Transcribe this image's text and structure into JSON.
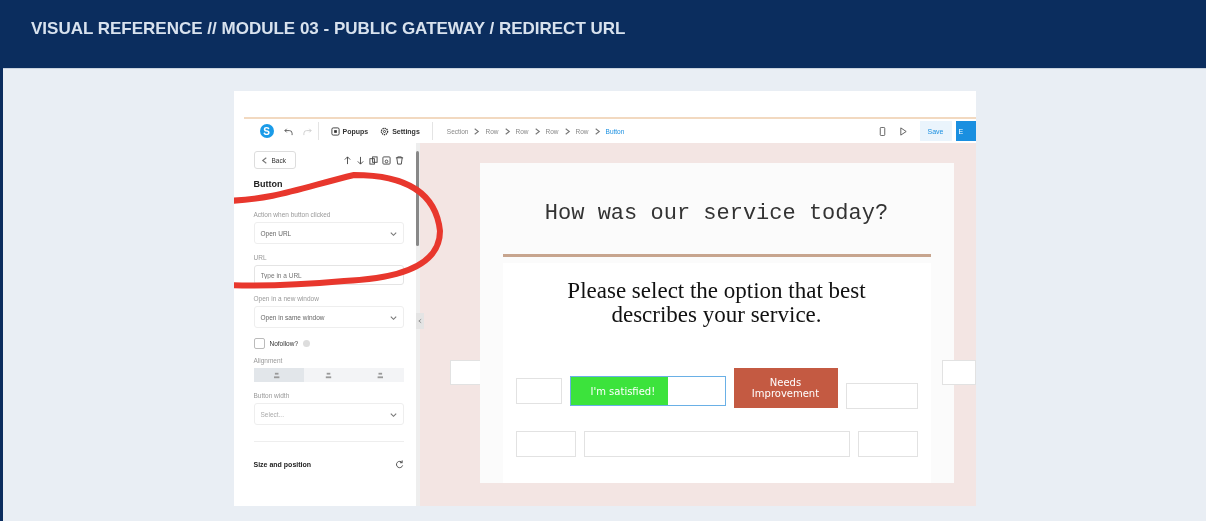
{
  "header": {
    "title": "VISUAL REFERENCE // MODULE 03 - PUBLIC GATEWAY / REDIRECT URL"
  },
  "toolbar": {
    "logo": "S",
    "menu": [
      {
        "label": "Popups",
        "kind": "popups"
      },
      {
        "label": "Settings",
        "kind": "settings"
      }
    ],
    "breadcrumbs": [
      {
        "label": "Section",
        "selected": false
      },
      {
        "label": "Row",
        "selected": false
      },
      {
        "label": "Row",
        "selected": false
      },
      {
        "label": "Row",
        "selected": false
      },
      {
        "label": "Row",
        "selected": false
      },
      {
        "label": "Button",
        "selected": true
      }
    ],
    "save": "Save",
    "export": "E"
  },
  "panel": {
    "back": "Back",
    "title": "Button",
    "fields": [
      {
        "label": "Action when button clicked",
        "kind": "select",
        "value": "Open URL"
      },
      {
        "label": "URL",
        "kind": "input",
        "placeholder": "Type in a URL"
      },
      {
        "label": "Open in a new window",
        "kind": "select",
        "value": "Open in same window"
      }
    ],
    "nofollow": {
      "label": "Nofollow?",
      "checked": false
    },
    "alignment": {
      "label": "Alignment",
      "options": [
        {
          "kind": "left",
          "selected": true
        },
        {
          "kind": "center",
          "selected": false
        },
        {
          "kind": "right",
          "selected": false
        }
      ]
    },
    "width": {
      "label": "Button width",
      "placeholder": "Select..."
    },
    "section": "Size and position"
  },
  "canvas": {
    "heading": "How was our service today?",
    "question": "Please select the option that best describes your service.",
    "buttons": [
      {
        "label": "I'm satisfied!",
        "kind": "positive"
      },
      {
        "label": "Needs Improvement",
        "kind": "negative"
      }
    ]
  }
}
